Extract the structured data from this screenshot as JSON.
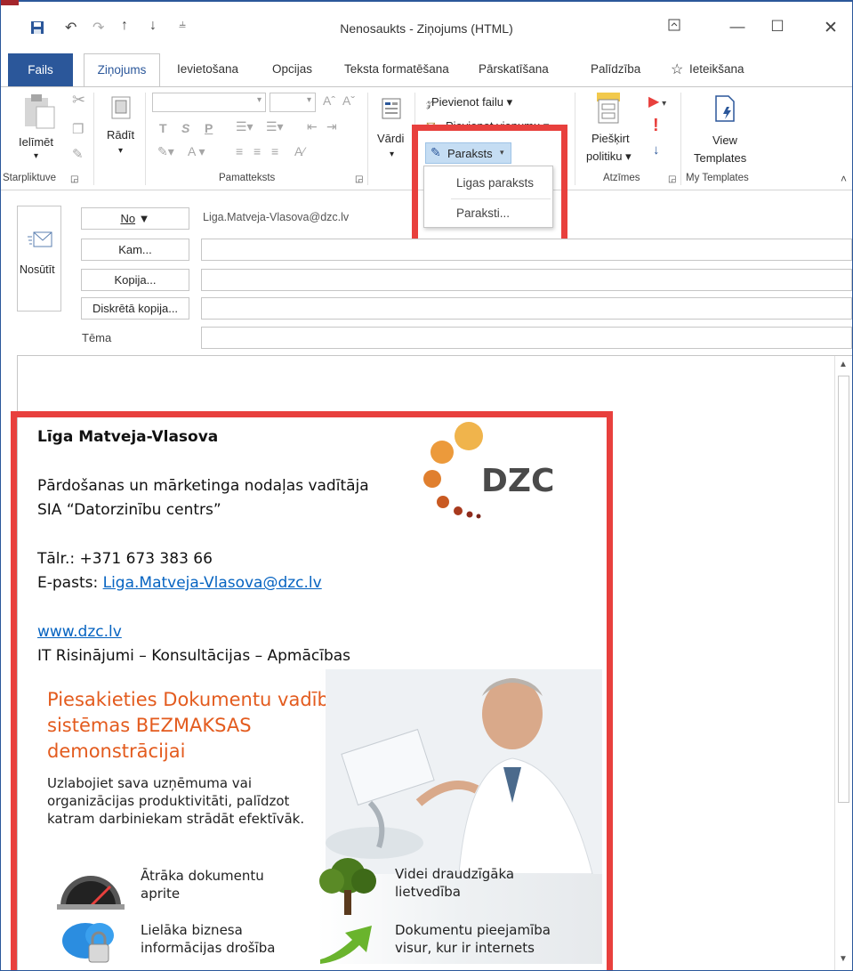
{
  "titlebar": {
    "title": "Nenosaukts  -  Ziņojums (HTML)",
    "save_icon": "save-icon",
    "undo_icon": "undo-icon",
    "redo_icon": "redo-icon",
    "up_icon": "arrow-up-icon",
    "down_icon": "arrow-down-icon",
    "customize_icon": "customize-qat-icon"
  },
  "tabs": {
    "file": "Fails",
    "active": "Ziņojums",
    "items": [
      "Ievietošana",
      "Opcijas",
      "Teksta formatēšana",
      "Pārskatīšana",
      "Palīdzība"
    ],
    "tellme": "Ieteikšana"
  },
  "ribbon": {
    "clipboard": {
      "paste": "Ielīmēt",
      "group": "Starpliktuve"
    },
    "show": {
      "label": "Rādīt"
    },
    "basic_text": {
      "group": "Pamatteksts",
      "bold": "T",
      "italic": "S",
      "underline": "P"
    },
    "names": {
      "label": "Vārdi"
    },
    "include": {
      "attach_file": "Pievienot failu",
      "attach_item": "Pievienot vienumu",
      "signature": "Paraksts"
    },
    "policy": {
      "label1": "Piešķirt",
      "label2": "politiku"
    },
    "tags": {
      "group": "Atzīmes"
    },
    "templates": {
      "view": "View",
      "templates": "Templates",
      "group": "My Templates"
    }
  },
  "dropdown": {
    "items": [
      "Ligas paraksts",
      "Paraksti..."
    ]
  },
  "header": {
    "send": "Nosūtīt",
    "from_btn": "No",
    "from_value": "Liga.Matveja-Vlasova@dzc.lv",
    "to_btn": "Kam...",
    "cc_btn": "Kopija...",
    "bcc_btn": "Diskrētā kopija...",
    "subject_label": "Tēma"
  },
  "signature": {
    "name": "Līga Matveja-Vlasova",
    "position": "Pārdošanas un mārketinga nodaļas vadītāja",
    "company": "SIA “Datorzinību centrs”",
    "phone": "Tālr.: +371 673 383 66",
    "email_label": "E-pasts: ",
    "email": "Liga.Matveja-Vlasova@dzc.lv",
    "website": "www.dzc.lv",
    "tagline": "IT Risinājumi – Konsultācijas – Apmācības",
    "logo_text": "DZC"
  },
  "banner": {
    "title_lines": [
      "Piesakieties Dokumentu vadības",
      "sistēmas BEZMAKSAS",
      "demonstrācijai"
    ],
    "sub_lines": [
      "Uzlabojiet sava uzņēmuma vai",
      "organizācijas produktivitāti, palīdzot",
      "katram darbiniekam strādāt efektīvāk."
    ],
    "features": [
      {
        "line1": "Ātrāka dokumentu",
        "line2": "aprite",
        "icon": "speedometer-icon"
      },
      {
        "line1": "Videi draudzīgāka",
        "line2": "lietvedība",
        "icon": "tree-icon"
      },
      {
        "line1": "Lielāka biznesa",
        "line2": "informācijas drošība",
        "icon": "cloud-lock-icon"
      },
      {
        "line1": "Dokumentu pieejamība",
        "line2": "visur, kur ir internets",
        "icon": "green-arrow-icon"
      }
    ]
  },
  "colors": {
    "accent": "#2b579a",
    "highlight_box": "#e8403d",
    "banner_title": "#e35b1e",
    "link": "#0563c1",
    "logo_orange": "#e8a23c"
  }
}
